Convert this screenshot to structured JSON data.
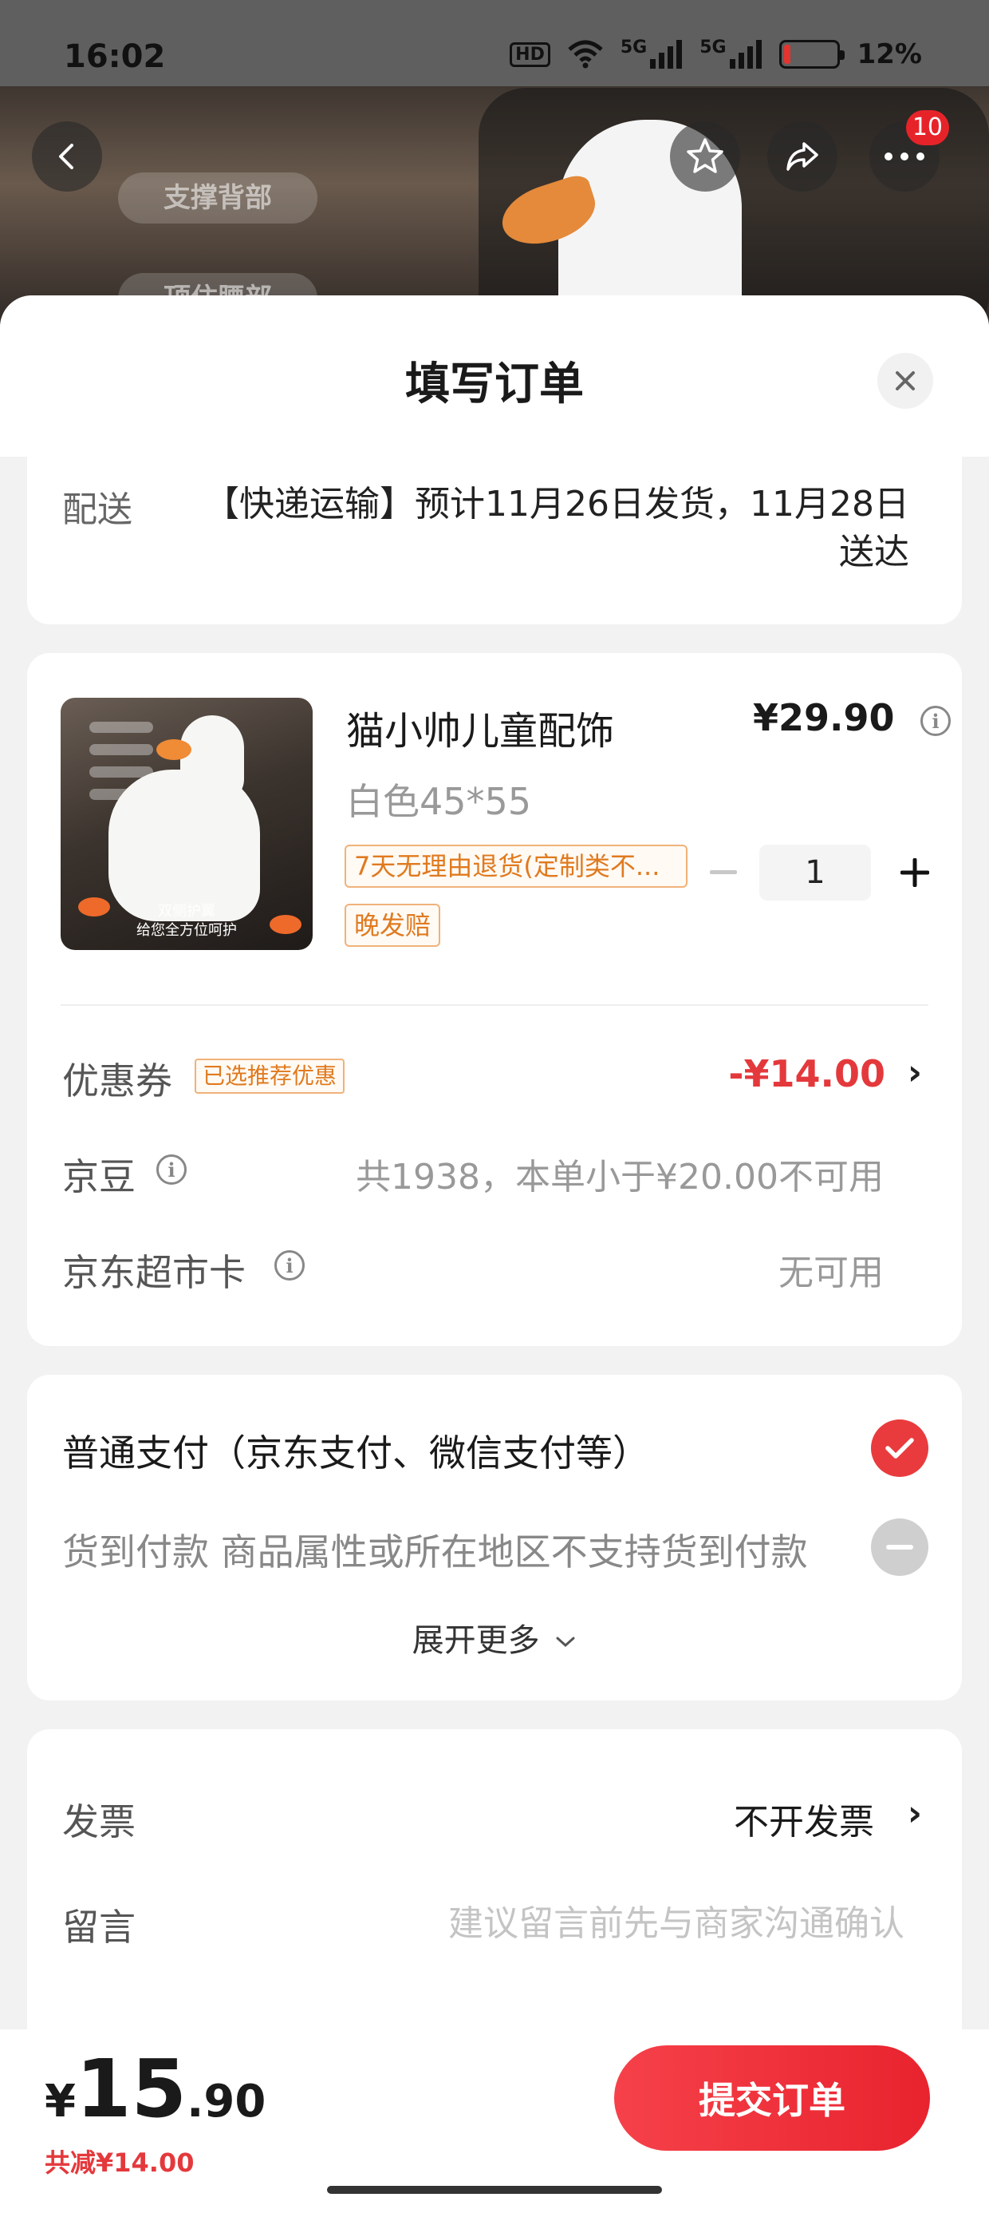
{
  "status_bar": {
    "time": "16:02",
    "hd": "HD",
    "network1": "5G",
    "network2": "5G",
    "battery_text": "12%",
    "battery_level": 0.12
  },
  "backdrop": {
    "label_top": "支撑背部",
    "label_bottom": "顶住腰部"
  },
  "nav": {
    "more_badge": "10"
  },
  "sheet": {
    "title": "填写订单"
  },
  "delivery": {
    "label": "配送",
    "value": "【快递运输】预计11月26日发货，11月28日送达"
  },
  "product": {
    "name": "猫小帅儿童配饰",
    "price": "¥29.90",
    "spec": "白色45*55",
    "tag_return": "7天无理由退货(定制类不...",
    "tag_late": "晚发赔",
    "quantity": "1",
    "image_caption_line1": "双侧护翼",
    "image_caption_line2": "给您全方位呵护"
  },
  "coupon": {
    "label": "优惠券",
    "badge": "已选推荐优惠",
    "value": "-¥14.00"
  },
  "jingdou": {
    "label": "京豆",
    "value": "共1938，本单小于¥20.00不可用"
  },
  "supermarket_card": {
    "label": "京东超市卡",
    "value": "无可用"
  },
  "payment": {
    "normal": "普通支付（京东支付、微信支付等）",
    "cod": "货到付款 商品属性或所在地区不支持货到付款",
    "expand": "展开更多"
  },
  "invoice": {
    "label": "发票",
    "value": "不开发票"
  },
  "message": {
    "label": "留言",
    "placeholder": "建议留言前先与商家沟通确认"
  },
  "bottom": {
    "currency": "¥",
    "total_int": "15",
    "total_dec": ".90",
    "saved": "共减¥14.00",
    "submit": "提交订单"
  },
  "colors": {
    "accent": "#e93b3d",
    "price_red": "#e4393c",
    "tag_orange": "#e07a1f"
  },
  "icons": [
    "back-icon",
    "star-icon",
    "share-icon",
    "more-icon",
    "close-icon",
    "info-icon",
    "check-icon",
    "chevron-right-icon",
    "chevron-down-icon"
  ]
}
